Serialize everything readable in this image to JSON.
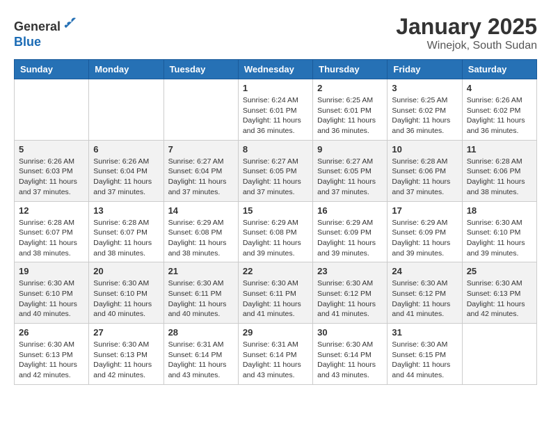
{
  "header": {
    "logo_line1": "General",
    "logo_line2": "Blue",
    "month": "January 2025",
    "location": "Winejok, South Sudan"
  },
  "days_of_week": [
    "Sunday",
    "Monday",
    "Tuesday",
    "Wednesday",
    "Thursday",
    "Friday",
    "Saturday"
  ],
  "weeks": [
    [
      {
        "day": "",
        "info": ""
      },
      {
        "day": "",
        "info": ""
      },
      {
        "day": "",
        "info": ""
      },
      {
        "day": "1",
        "info": "Sunrise: 6:24 AM\nSunset: 6:01 PM\nDaylight: 11 hours\nand 36 minutes."
      },
      {
        "day": "2",
        "info": "Sunrise: 6:25 AM\nSunset: 6:01 PM\nDaylight: 11 hours\nand 36 minutes."
      },
      {
        "day": "3",
        "info": "Sunrise: 6:25 AM\nSunset: 6:02 PM\nDaylight: 11 hours\nand 36 minutes."
      },
      {
        "day": "4",
        "info": "Sunrise: 6:26 AM\nSunset: 6:02 PM\nDaylight: 11 hours\nand 36 minutes."
      }
    ],
    [
      {
        "day": "5",
        "info": "Sunrise: 6:26 AM\nSunset: 6:03 PM\nDaylight: 11 hours\nand 37 minutes."
      },
      {
        "day": "6",
        "info": "Sunrise: 6:26 AM\nSunset: 6:04 PM\nDaylight: 11 hours\nand 37 minutes."
      },
      {
        "day": "7",
        "info": "Sunrise: 6:27 AM\nSunset: 6:04 PM\nDaylight: 11 hours\nand 37 minutes."
      },
      {
        "day": "8",
        "info": "Sunrise: 6:27 AM\nSunset: 6:05 PM\nDaylight: 11 hours\nand 37 minutes."
      },
      {
        "day": "9",
        "info": "Sunrise: 6:27 AM\nSunset: 6:05 PM\nDaylight: 11 hours\nand 37 minutes."
      },
      {
        "day": "10",
        "info": "Sunrise: 6:28 AM\nSunset: 6:06 PM\nDaylight: 11 hours\nand 37 minutes."
      },
      {
        "day": "11",
        "info": "Sunrise: 6:28 AM\nSunset: 6:06 PM\nDaylight: 11 hours\nand 38 minutes."
      }
    ],
    [
      {
        "day": "12",
        "info": "Sunrise: 6:28 AM\nSunset: 6:07 PM\nDaylight: 11 hours\nand 38 minutes."
      },
      {
        "day": "13",
        "info": "Sunrise: 6:28 AM\nSunset: 6:07 PM\nDaylight: 11 hours\nand 38 minutes."
      },
      {
        "day": "14",
        "info": "Sunrise: 6:29 AM\nSunset: 6:08 PM\nDaylight: 11 hours\nand 38 minutes."
      },
      {
        "day": "15",
        "info": "Sunrise: 6:29 AM\nSunset: 6:08 PM\nDaylight: 11 hours\nand 39 minutes."
      },
      {
        "day": "16",
        "info": "Sunrise: 6:29 AM\nSunset: 6:09 PM\nDaylight: 11 hours\nand 39 minutes."
      },
      {
        "day": "17",
        "info": "Sunrise: 6:29 AM\nSunset: 6:09 PM\nDaylight: 11 hours\nand 39 minutes."
      },
      {
        "day": "18",
        "info": "Sunrise: 6:30 AM\nSunset: 6:10 PM\nDaylight: 11 hours\nand 39 minutes."
      }
    ],
    [
      {
        "day": "19",
        "info": "Sunrise: 6:30 AM\nSunset: 6:10 PM\nDaylight: 11 hours\nand 40 minutes."
      },
      {
        "day": "20",
        "info": "Sunrise: 6:30 AM\nSunset: 6:10 PM\nDaylight: 11 hours\nand 40 minutes."
      },
      {
        "day": "21",
        "info": "Sunrise: 6:30 AM\nSunset: 6:11 PM\nDaylight: 11 hours\nand 40 minutes."
      },
      {
        "day": "22",
        "info": "Sunrise: 6:30 AM\nSunset: 6:11 PM\nDaylight: 11 hours\nand 41 minutes."
      },
      {
        "day": "23",
        "info": "Sunrise: 6:30 AM\nSunset: 6:12 PM\nDaylight: 11 hours\nand 41 minutes."
      },
      {
        "day": "24",
        "info": "Sunrise: 6:30 AM\nSunset: 6:12 PM\nDaylight: 11 hours\nand 41 minutes."
      },
      {
        "day": "25",
        "info": "Sunrise: 6:30 AM\nSunset: 6:13 PM\nDaylight: 11 hours\nand 42 minutes."
      }
    ],
    [
      {
        "day": "26",
        "info": "Sunrise: 6:30 AM\nSunset: 6:13 PM\nDaylight: 11 hours\nand 42 minutes."
      },
      {
        "day": "27",
        "info": "Sunrise: 6:30 AM\nSunset: 6:13 PM\nDaylight: 11 hours\nand 42 minutes."
      },
      {
        "day": "28",
        "info": "Sunrise: 6:31 AM\nSunset: 6:14 PM\nDaylight: 11 hours\nand 43 minutes."
      },
      {
        "day": "29",
        "info": "Sunrise: 6:31 AM\nSunset: 6:14 PM\nDaylight: 11 hours\nand 43 minutes."
      },
      {
        "day": "30",
        "info": "Sunrise: 6:30 AM\nSunset: 6:14 PM\nDaylight: 11 hours\nand 43 minutes."
      },
      {
        "day": "31",
        "info": "Sunrise: 6:30 AM\nSunset: 6:15 PM\nDaylight: 11 hours\nand 44 minutes."
      },
      {
        "day": "",
        "info": ""
      }
    ]
  ]
}
